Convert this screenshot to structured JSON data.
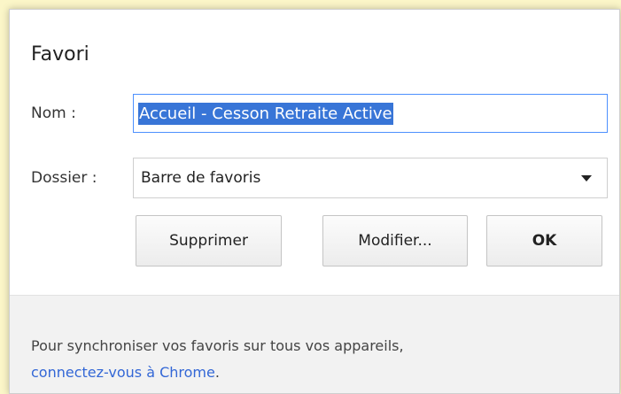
{
  "dialog": {
    "title": "Favori",
    "name_label": "Nom :",
    "name_value": "Accueil - Cesson Retraite Active",
    "folder_label": "Dossier :",
    "folder_value": "Barre de favoris",
    "buttons": {
      "delete": "Supprimer",
      "edit": "Modifier...",
      "ok": "OK"
    }
  },
  "footer": {
    "text": "Pour synchroniser vos favoris sur tous vos appareils,",
    "link": "connectez-vous à Chrome",
    "suffix": "."
  },
  "colors": {
    "selection": "#3875d7",
    "link": "#3367d6",
    "background": "#fbf6c8"
  }
}
